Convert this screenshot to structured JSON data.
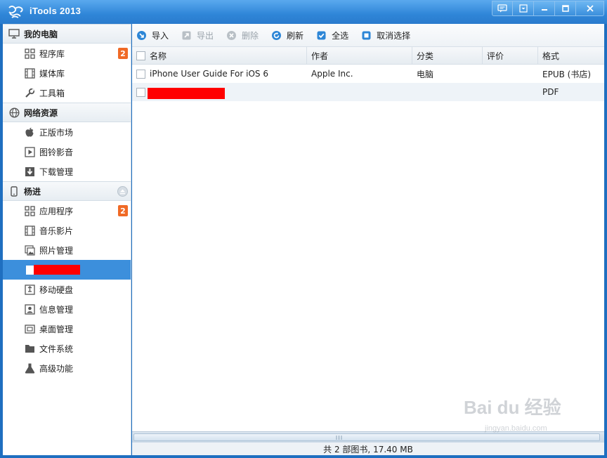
{
  "app": {
    "title": "iTools 2013"
  },
  "sidebar": {
    "groups": [
      {
        "label": "我的电脑",
        "items": [
          {
            "label": "程序库",
            "badge": "2"
          },
          {
            "label": "媒体库"
          },
          {
            "label": "工具箱"
          }
        ]
      },
      {
        "label": "网络资源",
        "items": [
          {
            "label": "正版市场"
          },
          {
            "label": "图铃影音"
          },
          {
            "label": "下载管理"
          }
        ]
      },
      {
        "label": "杨进",
        "items": [
          {
            "label": "应用程序",
            "badge": "2"
          },
          {
            "label": "音乐影片"
          },
          {
            "label": "照片管理"
          },
          {
            "label": "",
            "redacted": true,
            "active": true
          },
          {
            "label": "移动硬盘"
          },
          {
            "label": "信息管理"
          },
          {
            "label": "桌面管理"
          },
          {
            "label": "文件系统"
          },
          {
            "label": "高级功能"
          }
        ]
      }
    ]
  },
  "toolbar": {
    "import": "导入",
    "export": "导出",
    "delete": "删除",
    "refresh": "刷新",
    "select_all": "全选",
    "deselect": "取消选择"
  },
  "table": {
    "headers": [
      "名称",
      "作者",
      "分类",
      "评价",
      "格式"
    ],
    "rows": [
      {
        "name": "iPhone User Guide For iOS 6",
        "author": "Apple Inc.",
        "category": "电脑",
        "rating": "",
        "format": "EPUB (书店)"
      },
      {
        "name": "",
        "author": "",
        "category": "",
        "rating": "",
        "format": "PDF",
        "redacted": true
      }
    ]
  },
  "status": "共 2 部图书, 17.40 MB",
  "watermark": {
    "text": "Bai du 经验",
    "sub": "jingyan.baidu.com"
  }
}
